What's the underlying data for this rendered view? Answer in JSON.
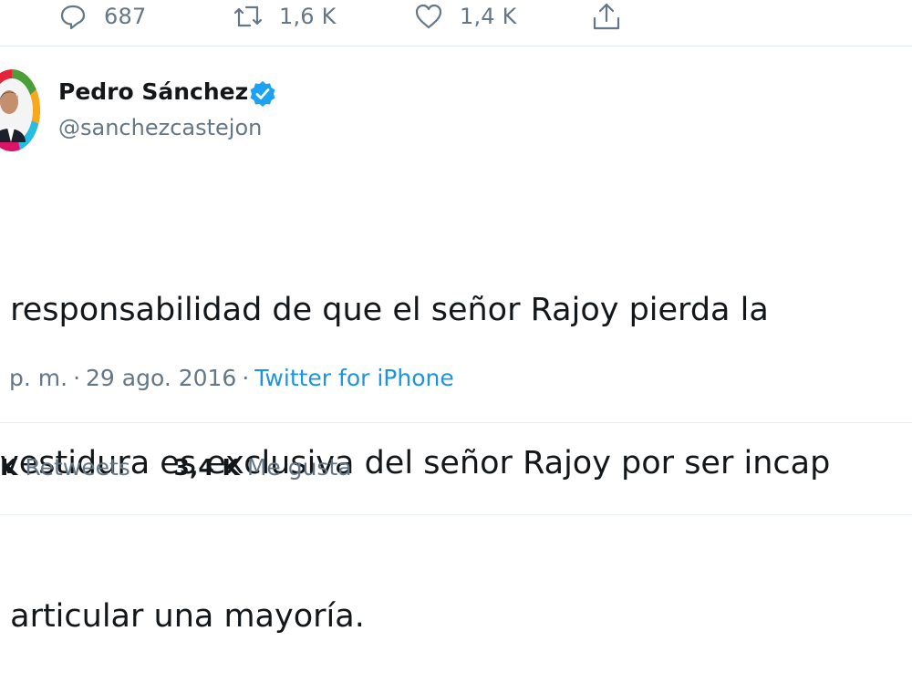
{
  "actions": {
    "reply": {
      "icon": "reply-icon",
      "count": "687"
    },
    "retweet": {
      "icon": "retweet-icon",
      "count": "1,6 K"
    },
    "like": {
      "icon": "heart-icon",
      "count": "1,4 K"
    },
    "share": {
      "icon": "share-icon"
    }
  },
  "author": {
    "name": "Pedro Sánchez",
    "handle": "@sanchezcastejon",
    "verified_icon": "verified-badge-icon"
  },
  "tweet": {
    "lines": [
      " responsabilidad de que el señor Rajoy pierda la",
      "vestidura es exclusiva del señor Rajoy por ser incap",
      " articular una mayoría."
    ],
    "time": "p. m.",
    "separator": "·",
    "date": "29 ago. 2016",
    "source": "Twitter for iPhone"
  },
  "stats": {
    "retweets_count": "K",
    "retweets_label": "Retweets",
    "likes_count": "3,4 K",
    "likes_label": "Me gusta"
  },
  "colors": {
    "text": "#14171a",
    "secondary": "#657786",
    "link": "#1b95e0",
    "verified": "#1da1f2",
    "divider": "#e6ecf0"
  }
}
